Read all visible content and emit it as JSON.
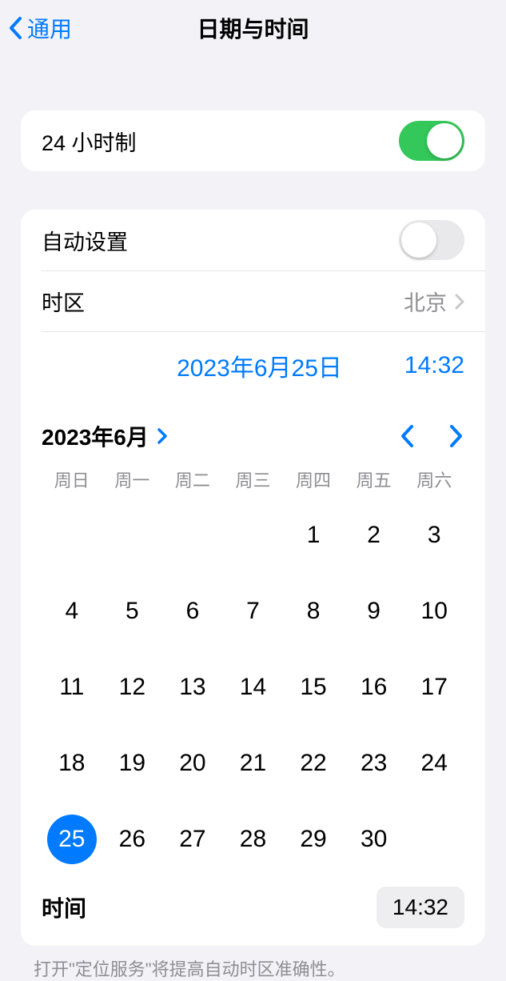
{
  "nav": {
    "back_label": "通用",
    "title": "日期与时间"
  },
  "settings": {
    "twenty_four_hour_label": "24 小时制",
    "twenty_four_hour_on": true,
    "auto_set_label": "自动设置",
    "auto_set_on": false,
    "timezone_label": "时区",
    "timezone_value": "北京"
  },
  "picker": {
    "date_display": "2023年6月25日",
    "time_display": "14:32"
  },
  "calendar": {
    "month_label": "2023年6月",
    "weekdays": [
      "周日",
      "周一",
      "周二",
      "周三",
      "周四",
      "周五",
      "周六"
    ],
    "leading_blanks": 4,
    "days": [
      1,
      2,
      3,
      4,
      5,
      6,
      7,
      8,
      9,
      10,
      11,
      12,
      13,
      14,
      15,
      16,
      17,
      18,
      19,
      20,
      21,
      22,
      23,
      24,
      25,
      26,
      27,
      28,
      29,
      30
    ],
    "selected_day": 25
  },
  "time_row": {
    "label": "时间",
    "value": "14:32"
  },
  "footer": "打开\"定位服务\"将提高自动时区准确性。",
  "colors": {
    "accent": "#007aff",
    "green": "#34c759",
    "gray_text": "#8e8e93"
  }
}
